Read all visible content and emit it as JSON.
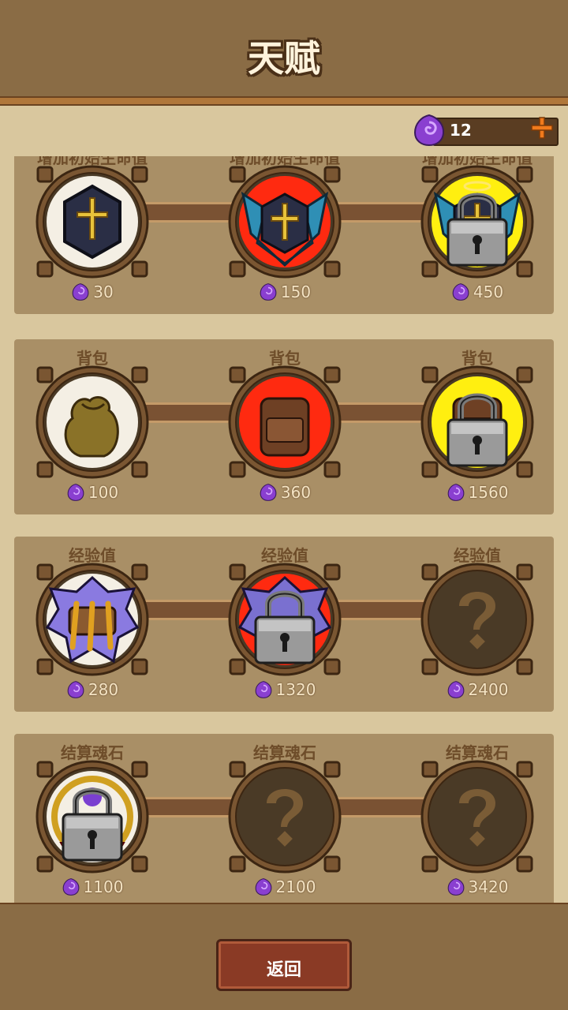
{
  "screen_title": "天赋",
  "currency": {
    "icon": "soul-stone-icon",
    "amount": "12"
  },
  "rows": [
    {
      "nodes": [
        {
          "label": "增加初始生命值",
          "cost": "30",
          "state": "unlocked",
          "glow": "#ffffff",
          "icon": "cross-shield-icon"
        },
        {
          "label": "增加初始生命值",
          "cost": "150",
          "state": "unlocked",
          "glow": "#ff2a10",
          "icon": "winged-cross-shield-icon"
        },
        {
          "label": "增加初始生命值",
          "cost": "450",
          "state": "locked",
          "glow": "#ffef10",
          "icon": "winged-halo-shield-icon"
        }
      ]
    },
    {
      "nodes": [
        {
          "label": "背包",
          "cost": "100",
          "state": "unlocked",
          "glow": "#ffffff",
          "icon": "sack-icon"
        },
        {
          "label": "背包",
          "cost": "360",
          "state": "unlocked",
          "glow": "#ff2a10",
          "icon": "backpack-icon"
        },
        {
          "label": "背包",
          "cost": "1560",
          "state": "locked",
          "glow": "#ffef10",
          "icon": "backpack-icon"
        }
      ]
    },
    {
      "nodes": [
        {
          "label": "经验值",
          "cost": "280",
          "state": "unlocked",
          "glow": "#ffffff",
          "icon": "scroll-icon"
        },
        {
          "label": "经验值",
          "cost": "1320",
          "state": "locked",
          "glow": "#ff2a10",
          "icon": "rune-scroll-icon"
        },
        {
          "label": "经验值",
          "cost": "2400",
          "state": "unknown",
          "glow": "",
          "icon": "question-mark-icon"
        }
      ]
    },
    {
      "nodes": [
        {
          "label": "结算魂石",
          "cost": "1100",
          "state": "locked",
          "glow": "#ffffff",
          "icon": "soul-gem-icon"
        },
        {
          "label": "结算魂石",
          "cost": "2100",
          "state": "unknown",
          "glow": "",
          "icon": "question-mark-icon"
        },
        {
          "label": "结算魂石",
          "cost": "3420",
          "state": "unknown",
          "glow": "",
          "icon": "question-mark-icon"
        }
      ]
    }
  ],
  "back_button": {
    "label": "返回"
  },
  "colors": {
    "gem": "#8a3fd0",
    "panel": "#a98f66",
    "accent": "#f07a1c"
  }
}
